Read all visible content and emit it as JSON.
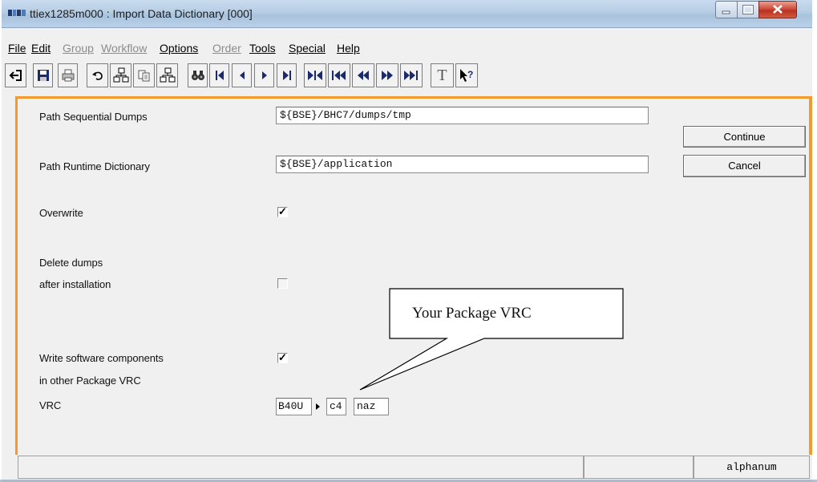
{
  "window": {
    "title": "ttiex1285m000 : Import Data Dictionary [000]"
  },
  "menu": [
    {
      "label": "File",
      "enabled": true
    },
    {
      "label": "Edit",
      "enabled": true
    },
    {
      "label": "Group",
      "enabled": false
    },
    {
      "label": "Workflow",
      "enabled": false
    },
    {
      "label": "Options",
      "enabled": true
    },
    {
      "label": "Order",
      "enabled": false
    },
    {
      "label": "Tools",
      "enabled": true
    },
    {
      "label": "Special",
      "enabled": true
    },
    {
      "label": "Help",
      "enabled": true
    }
  ],
  "toolbar": {
    "text_label": "T",
    "help_label": "?"
  },
  "form": {
    "path_sequential_dumps": {
      "label": "Path Sequential Dumps",
      "value": "${BSE}/BHC7/dumps/tmp"
    },
    "path_runtime_dictionary": {
      "label": "Path Runtime Dictionary",
      "value": "${BSE}/application"
    },
    "overwrite": {
      "label": "Overwrite",
      "checked": true
    },
    "delete_dumps": {
      "label_line1": "Delete dumps",
      "label_line2": "after installation",
      "checked": false
    },
    "write_components": {
      "label_line1": "Write software components",
      "label_line2": "in other Package VRC",
      "checked": true
    },
    "vrc": {
      "label": "VRC",
      "package": "B40U",
      "release": "c4",
      "customer": "naz"
    }
  },
  "buttons": {
    "continue": "Continue",
    "cancel": "Cancel"
  },
  "callout": {
    "text": "Your Package VRC"
  },
  "status": {
    "field_type": "alphanum"
  }
}
